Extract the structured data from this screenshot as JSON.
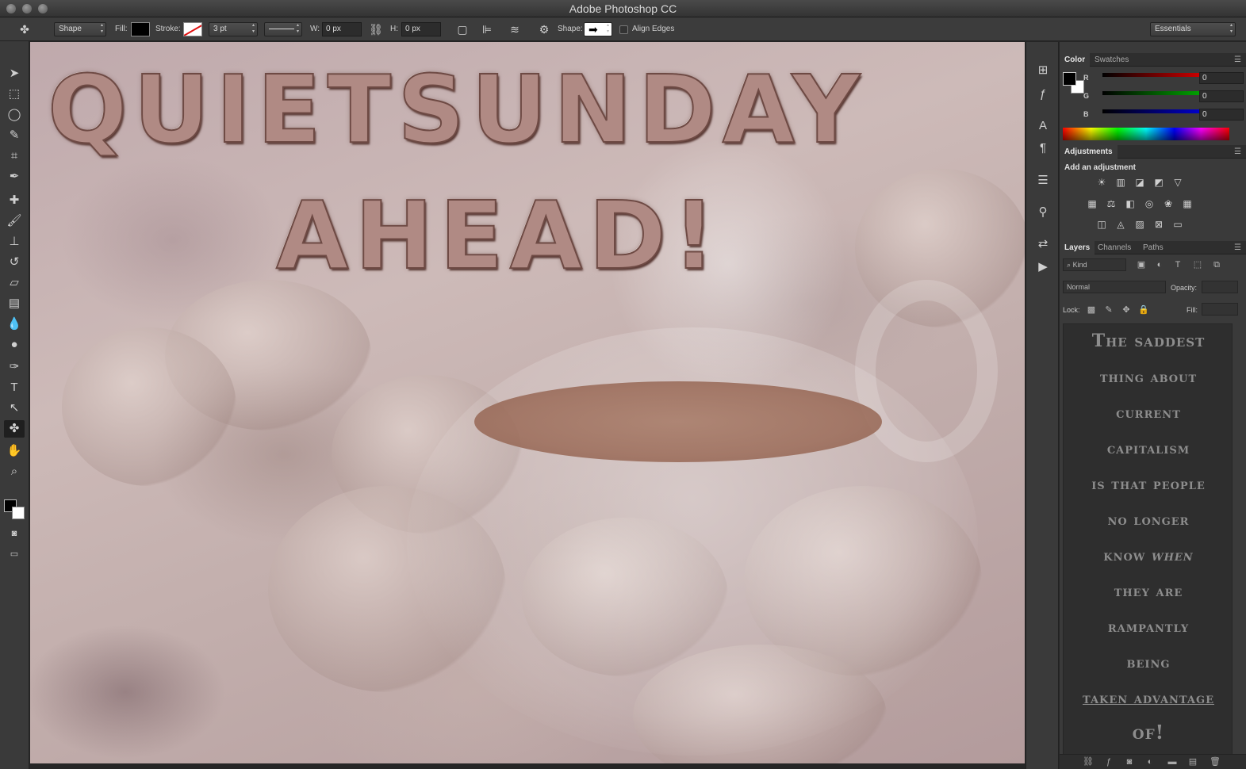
{
  "app": {
    "title": "Adobe Photoshop CC"
  },
  "options_bar": {
    "mode": "Shape",
    "fill_label": "Fill:",
    "stroke_label": "Stroke:",
    "stroke_width": "3 pt",
    "width_label": "W:",
    "width_value": "0 px",
    "height_label": "H:",
    "height_value": "0 px",
    "shape_label": "Shape:",
    "align_edges_label": "Align Edges",
    "workspace": "Essentials"
  },
  "colors": {
    "foreground": "#000000",
    "background": "#ffffff",
    "coffee": "#a77a66",
    "headline_text": "#b08a84"
  },
  "canvas": {
    "headline_line1": "QUIETSUNDAY",
    "headline_line2": "AHEAD!"
  },
  "color_panel": {
    "tabs": [
      "Color",
      "Swatches"
    ],
    "r_label": "R",
    "r_value": "0",
    "g_label": "G",
    "g_value": "0",
    "b_label": "B",
    "b_value": "0"
  },
  "adjustments_panel": {
    "tab": "Adjustments",
    "title": "Add an adjustment"
  },
  "layers_panel": {
    "tabs": [
      "Layers",
      "Channels",
      "Paths"
    ],
    "filter_kind": "Kind",
    "blend_mode": "Normal",
    "opacity_label": "Opacity:",
    "lock_label": "Lock:",
    "fill_label": "Fill:",
    "preview_text": {
      "line1": "The saddest",
      "line2": "thing about",
      "line3": "current",
      "line4": "capitalism",
      "line5": "is that people",
      "line6": "no longer",
      "line7a": "know",
      "line7b": "when",
      "line8": "they are",
      "line9": "rampantly",
      "line10": "being",
      "line11": "taken advantage",
      "line12": "of!"
    }
  }
}
